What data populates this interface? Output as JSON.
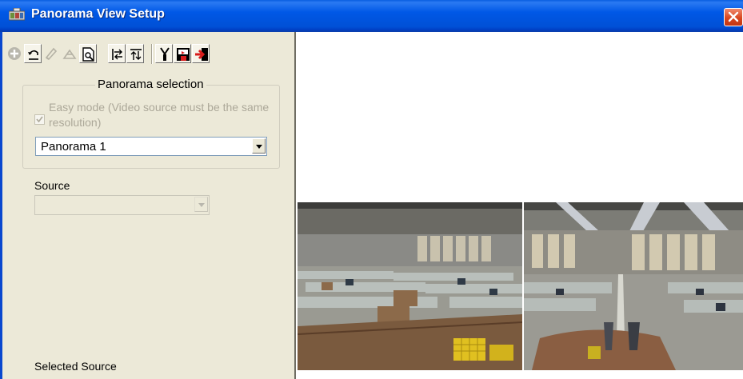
{
  "window": {
    "title": "Panorama View Setup",
    "close_label": "X"
  },
  "toolbar": {
    "buttons": [
      {
        "name": "add-icon",
        "enabled": false
      },
      {
        "name": "undo-icon",
        "enabled": true
      },
      {
        "name": "edit-icon",
        "enabled": false
      },
      {
        "name": "stitch-icon",
        "enabled": false
      },
      {
        "name": "preview-icon",
        "enabled": true
      },
      {
        "name": "align-horizontal-icon",
        "enabled": true,
        "pressed": true
      },
      {
        "name": "align-vertical-icon",
        "enabled": true
      },
      {
        "name": "cut-icon",
        "enabled": true
      },
      {
        "name": "save-icon",
        "enabled": true
      },
      {
        "name": "exit-icon",
        "enabled": true
      }
    ]
  },
  "panorama_selection": {
    "legend": "Panorama selection",
    "easy_mode_label": "Easy mode (Video source must be the same resolution)",
    "easy_mode_checked": true,
    "easy_mode_enabled": false,
    "selected_panorama": "Panorama 1"
  },
  "source": {
    "label": "Source",
    "value": "",
    "enabled": false
  },
  "selected_source": {
    "label": "Selected Source"
  },
  "preview": {
    "cameras": [
      "camera-view-1",
      "camera-view-2"
    ]
  },
  "colors": {
    "title_bar": "#0054e3",
    "panel_background": "#ece9d8",
    "close_button": "#d8461f",
    "disabled_text": "#aca899"
  }
}
